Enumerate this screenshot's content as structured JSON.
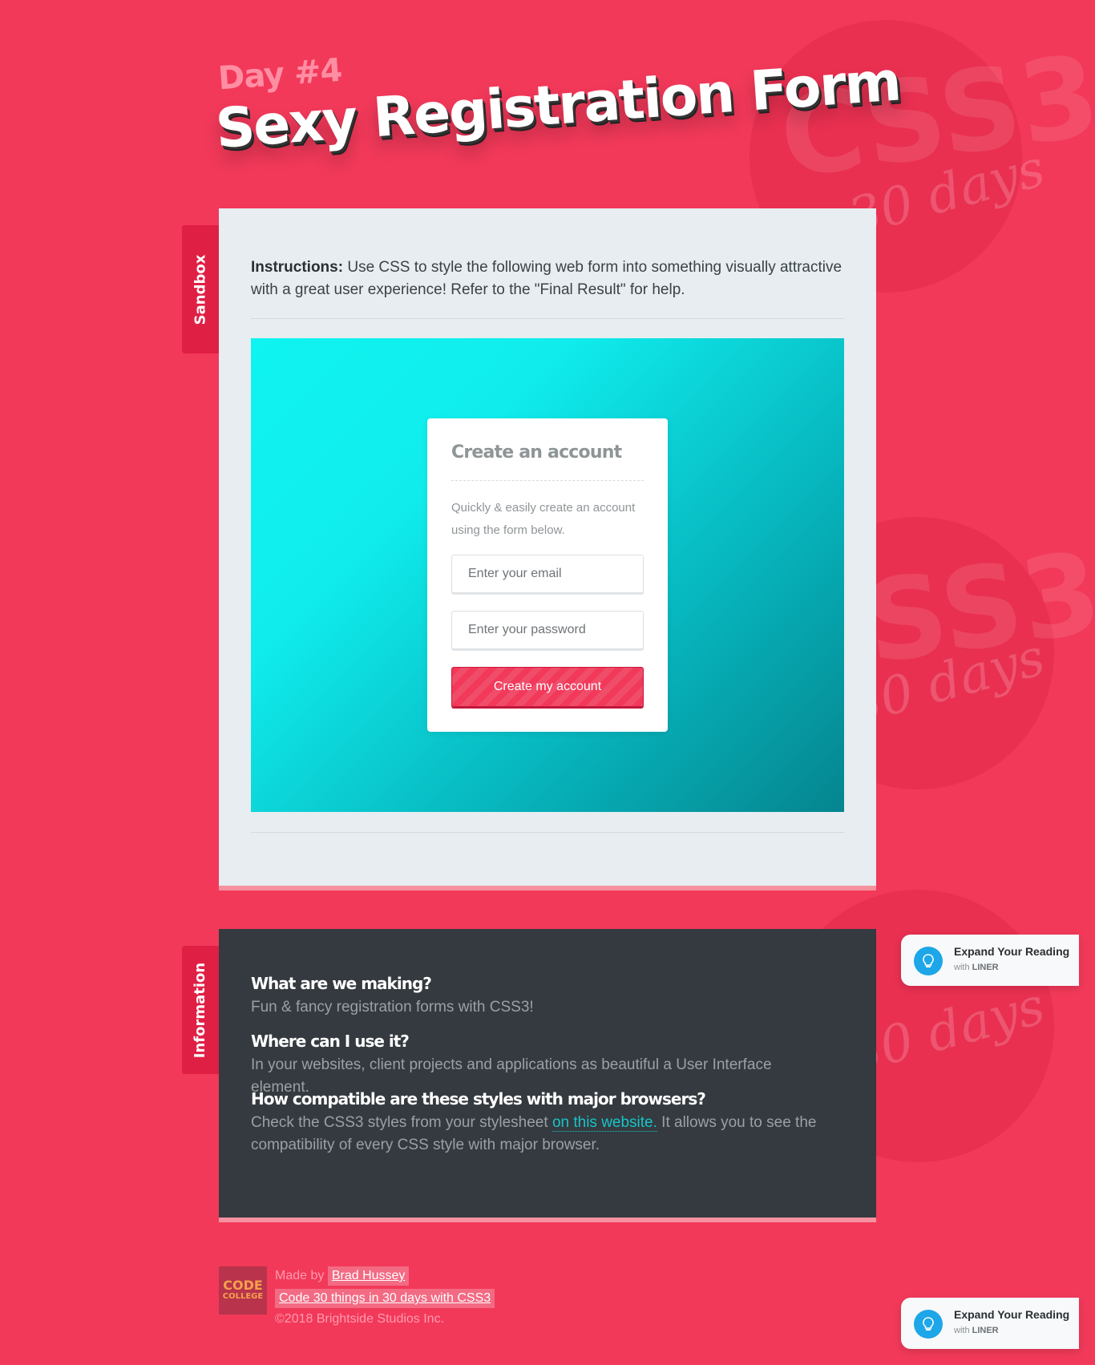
{
  "header": {
    "day": "Day #4",
    "title": "Sexy Registration Form"
  },
  "background": {
    "watermark_main": "CSS3",
    "watermark_sub": "in 30 days"
  },
  "sandbox": {
    "tab_label": "Sandbox",
    "instructions_label": "Instructions:",
    "instructions_text": " Use CSS to style the following web form into something visually attractive with a great user experience! Refer to the \"Final Result\" for help."
  },
  "form": {
    "title": "Create an account",
    "description": "Quickly & easily create an account using the form below.",
    "email_placeholder": "Enter your email",
    "password_placeholder": "Enter your password",
    "submit_label": "Create my account"
  },
  "information": {
    "tab_label": "Information",
    "items": [
      {
        "question": "What are we making?",
        "answer": "Fun & fancy registration forms with CSS3!"
      },
      {
        "question": "Where can I use it?",
        "answer": "In your websites, client projects and applications as beautiful a User Interface element."
      },
      {
        "question": "How compatible are these styles with major browsers?",
        "answer_before": "Check the CSS3 styles from your stylesheet ",
        "answer_link": "on this website.",
        "answer_after": " It allows you to see the compatibility of every CSS style with major browser."
      }
    ]
  },
  "footer": {
    "logo_line1": "CODE",
    "logo_line2": "COLLEGE",
    "made_by_label": "Made by",
    "author": "Brad Hussey",
    "course": "Code 30 things in 30 days with CSS3",
    "copyright": "©2018 Brightside Studios Inc."
  },
  "liner_widget": {
    "title": "Expand Your Reading",
    "with_label": "with",
    "brand": "LINER",
    "icon": "lightbulb-icon"
  },
  "colors": {
    "page_bg": "#f2395a",
    "accent_dark": "#e01f45",
    "teal": "#10ecec",
    "info_bg": "#343a3f",
    "link": "#18c4c9"
  }
}
